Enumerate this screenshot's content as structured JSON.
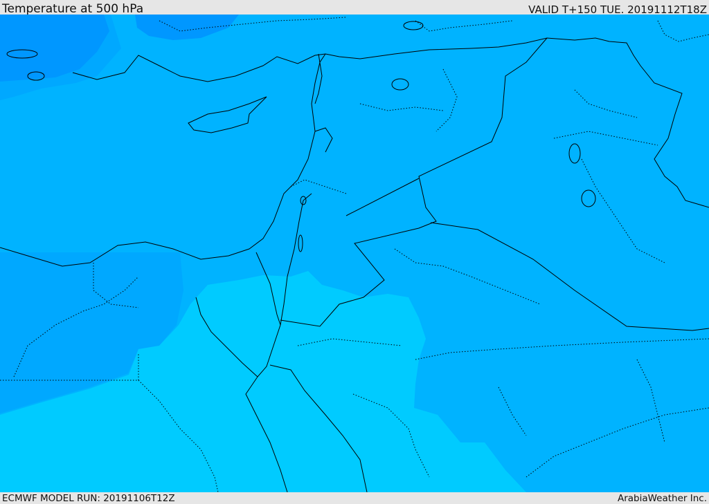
{
  "header": {
    "title": "Temperature at 500 hPa",
    "valid": "VALID T+150 TUE. 20191112T18Z"
  },
  "footer": {
    "model_run": "ECMWF MODEL RUN: 20191106T12Z",
    "credit": "ArabiaWeather Inc."
  },
  "colors": {
    "cold_band": "#0097ff",
    "mid_band": "#00a8ff",
    "base_band": "#00b3ff",
    "warm_band": "#00cbff",
    "border": "#000000",
    "frame": "#e6e6e6"
  }
}
